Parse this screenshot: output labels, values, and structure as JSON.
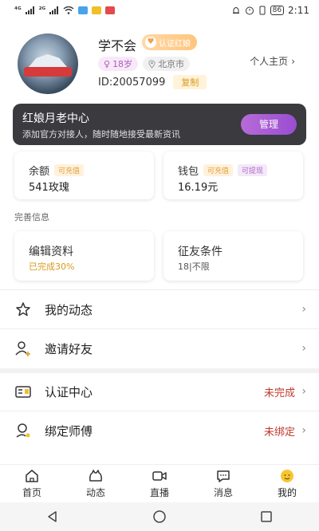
{
  "status_bar": {
    "signal_left": "⁴ᴳ",
    "signal_right": "²ᴳ",
    "battery": "86",
    "time": "2:11"
  },
  "profile": {
    "nickname": "学不会",
    "cert_badge": "认证红娘",
    "age": "18岁",
    "city": "北京市",
    "id_text": "ID:20057099",
    "copy_label": "复制",
    "home_link": "个人主页"
  },
  "banner": {
    "title": "红娘月老中心",
    "subtitle": "添加官方对接人，随时随地接受最新资讯",
    "button": "管理"
  },
  "wallet": {
    "balance_label": "余额",
    "balance_tag": "可充值",
    "balance_value": "541玫瑰",
    "wallet_label": "钱包",
    "wallet_tag1": "可充值",
    "wallet_tag2": "可提现",
    "wallet_value": "16.19元"
  },
  "complete_section": {
    "label": "完善信息",
    "edit_title": "编辑资料",
    "edit_sub": "已完成30%",
    "edit_progress": 30,
    "cond_title": "征友条件",
    "cond_sub": "18|不限"
  },
  "menu": [
    {
      "label": "我的动态",
      "status": ""
    },
    {
      "label": "邀请好友",
      "status": ""
    },
    {
      "label": "认证中心",
      "status": "未完成"
    },
    {
      "label": "绑定师傅",
      "status": "未绑定"
    }
  ],
  "bottom_nav": [
    {
      "label": "首页",
      "icon": "home-icon"
    },
    {
      "label": "动态",
      "icon": "moments-icon"
    },
    {
      "label": "直播",
      "icon": "video-icon"
    },
    {
      "label": "消息",
      "icon": "message-icon"
    },
    {
      "label": "我的",
      "icon": "me-icon"
    }
  ],
  "colors": {
    "accent_purple": "#9a4dd1",
    "gold": "#d99a1e",
    "status_red": "#c0392b",
    "banner_bg": "#3a3a3f"
  }
}
